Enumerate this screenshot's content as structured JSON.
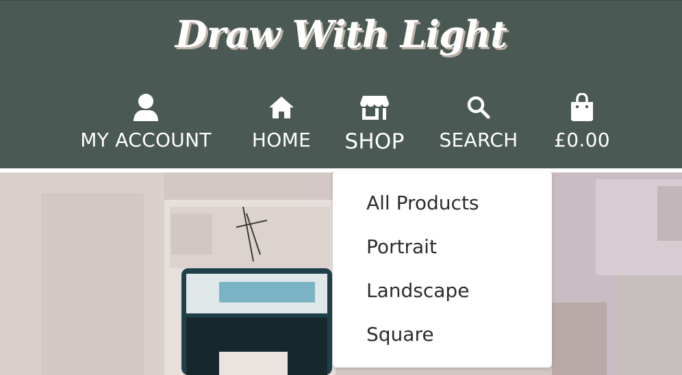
{
  "brand": {
    "title": "Draw With Light"
  },
  "nav": {
    "items": [
      {
        "id": "account",
        "label": "MY ACCOUNT",
        "icon": "user-icon"
      },
      {
        "id": "home",
        "label": "HOME",
        "icon": "home-icon"
      },
      {
        "id": "shop",
        "label": "SHOP",
        "icon": "store-icon"
      },
      {
        "id": "search",
        "label": "SEARCH",
        "icon": "search-icon"
      },
      {
        "id": "cart",
        "label": "£0.00",
        "icon": "shopping-bag-icon"
      }
    ]
  },
  "shop_menu": {
    "items": [
      {
        "label": "All Products"
      },
      {
        "label": "Portrait"
      },
      {
        "label": "Landscape"
      },
      {
        "label": "Square"
      }
    ]
  },
  "colors": {
    "header_bg": "#4a5953",
    "header_text": "#ffffff",
    "brand_shadow": "#bdb3a8",
    "menu_bg": "#ffffff",
    "menu_text": "#2b2b2b"
  }
}
